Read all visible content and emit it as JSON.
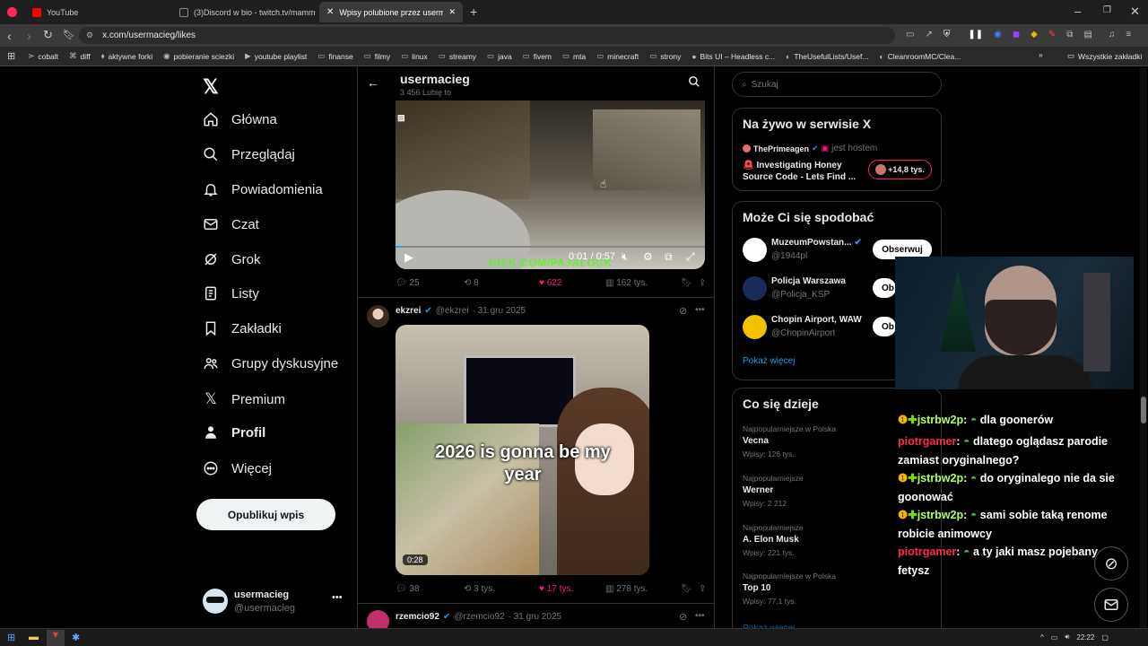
{
  "browser": {
    "tabs": [
      {
        "label": "YouTube",
        "color": "#ff0000"
      },
      {
        "label": "(3)Discord w bio - twitch.tv/mamm0n",
        "color": "#ffffff"
      },
      {
        "label": "Wpisy polubione przez usermacie",
        "color": "#ffffff",
        "active": true
      }
    ],
    "url": "x.com/usermacieg/likes",
    "bookmarks": [
      "cobalt",
      "diff",
      "aktywne forki",
      "pobieranie sciezki",
      "youtube playlist",
      "finanse",
      "filmy",
      "linux",
      "streamy",
      "java",
      "fivem",
      "mta",
      "minecraft",
      "strony",
      "Bits UI – Headless c...",
      "TheUsefulLists/Usef...",
      "CleanroomMC/Clea..."
    ],
    "all_bookmarks": "Wszystkie zakładki"
  },
  "nav": {
    "items": [
      "Główna",
      "Przeglądaj",
      "Powiadomienia",
      "Czat",
      "Grok",
      "Listy",
      "Zakładki",
      "Grupy dyskusyjne",
      "Premium",
      "Profil",
      "Więcej"
    ],
    "post_button": "Opublikuj wpis",
    "account_name": "usermacieg",
    "account_handle": "@usermacieg"
  },
  "header": {
    "name": "usermacieg",
    "count": "3 456 Lubię to"
  },
  "post1": {
    "video_time": "0:01 / 0:57",
    "overlay_text": "KICK.COM/PAJALOCK",
    "replies": "25",
    "reposts": "8",
    "likes": "622",
    "views": "162 tys."
  },
  "post2": {
    "name": "ekzrei",
    "handle": "@ekzrei",
    "date": "· 31 gru 2025",
    "media_caption": "2026 is gonna be my year",
    "duration": "0:28",
    "replies": "38",
    "reposts": "3 tys.",
    "likes": "17 tys.",
    "views": "278 tys."
  },
  "post3": {
    "name": "rzemcio92",
    "handle": "@rzemcio92",
    "date": "· 31 gru 2025"
  },
  "search": {
    "placeholder": "Szukaj"
  },
  "live": {
    "title": "Na żywo w serwisie X",
    "host": "ThePrimeagen",
    "host_suffix": "jest hostem",
    "line1": "Investigating Honey",
    "line2": "Source Code - Lets Find ...",
    "listeners": "+14,8 tys."
  },
  "suggest": {
    "title": "Może Ci się spodobać",
    "accounts": [
      {
        "name": "MuzeumPowstan...",
        "handle": "@1944pl"
      },
      {
        "name": "Policja Warszawa",
        "handle": "@Policja_KSP"
      },
      {
        "name": "Chopin Airport, WAW",
        "handle": "@ChopinAirport"
      }
    ],
    "follow_label": "Obserwuj",
    "follow_short": "Ob",
    "more": "Pokaż więcej"
  },
  "trends": {
    "title": "Co się dzieje",
    "items": [
      {
        "context": "Najpopularniejsze w Polska",
        "name": "Vecna",
        "posts": "Wpisy: 126 tys."
      },
      {
        "context": "Najpopularniejsze",
        "name": "Werner",
        "posts": "Wpisy: 2 212"
      },
      {
        "context": "Najpopularniejsze",
        "name": "A. Elon Musk",
        "posts": "Wpisy: 221 tys."
      },
      {
        "context": "Najpopularniejsze w Polska",
        "name": "Top 10",
        "posts": "Wpisy: 77,1 tys."
      }
    ],
    "more": "Pokaż więcej"
  },
  "chat": [
    {
      "user": "jstrbw2p",
      "color": "#b2ff59",
      "text": "dla goonerów"
    },
    {
      "user": "piotrgamer",
      "color": "#ff2b4a",
      "text": "dlatego oglądasz parodie zamiast oryginalnego?"
    },
    {
      "user": "jstrbw2p",
      "color": "#b2ff59",
      "text": "do oryginalego nie da sie goonować"
    },
    {
      "user": "jstrbw2p",
      "color": "#b2ff59",
      "text": "sami sobie taką renome robicie animowcy"
    },
    {
      "user": "piotrgamer",
      "color": "#ff2b4a",
      "text": "a ty jaki masz pojebany fetysz"
    }
  ],
  "taskbar": {
    "time": "22:22"
  },
  "colors": {
    "accent": "#1d9bf0",
    "like": "#f91880",
    "bg": "#000000"
  }
}
